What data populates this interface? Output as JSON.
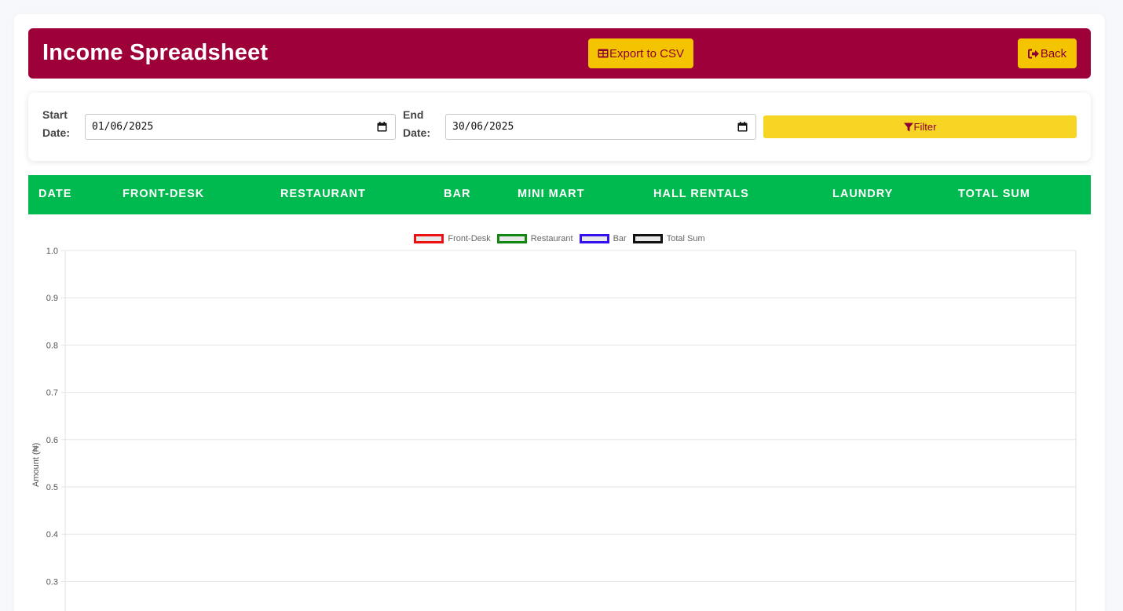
{
  "header": {
    "title": "Income Spreadsheet",
    "export_label": "Export to CSV",
    "back_label": "Back",
    "background": "#9e003a",
    "button_color": "#f5c400"
  },
  "filters": {
    "start_label_1": "Start",
    "start_label_2": "Date:",
    "start_value": "01/06/2025",
    "end_label_1": "End",
    "end_label_2": "Date:",
    "end_value": "30/06/2025",
    "filter_label": "Filter"
  },
  "table": {
    "header_color": "#00b94f",
    "columns": [
      "DATE",
      "FRONT-DESK",
      "RESTAURANT",
      "BAR",
      "MINI MART",
      "HALL RENTALS",
      "LAUNDRY",
      "TOTAL SUM"
    ],
    "rows": []
  },
  "chart_data": {
    "type": "line",
    "title": "",
    "xlabel": "",
    "ylabel": "Amount (₦)",
    "ylim": [
      0.3,
      1.0
    ],
    "yticks": [
      "1.0",
      "0.9",
      "0.8",
      "0.7",
      "0.6",
      "0.5",
      "0.4",
      "0.3"
    ],
    "grid": true,
    "legend_position": "top-center",
    "categories": [],
    "series": [
      {
        "name": "Front-Desk",
        "color": "#ee1111",
        "values": []
      },
      {
        "name": "Restaurant",
        "color": "#118811",
        "values": []
      },
      {
        "name": "Bar",
        "color": "#3311ee",
        "values": []
      },
      {
        "name": "Total Sum",
        "color": "#111111",
        "values": []
      }
    ]
  }
}
